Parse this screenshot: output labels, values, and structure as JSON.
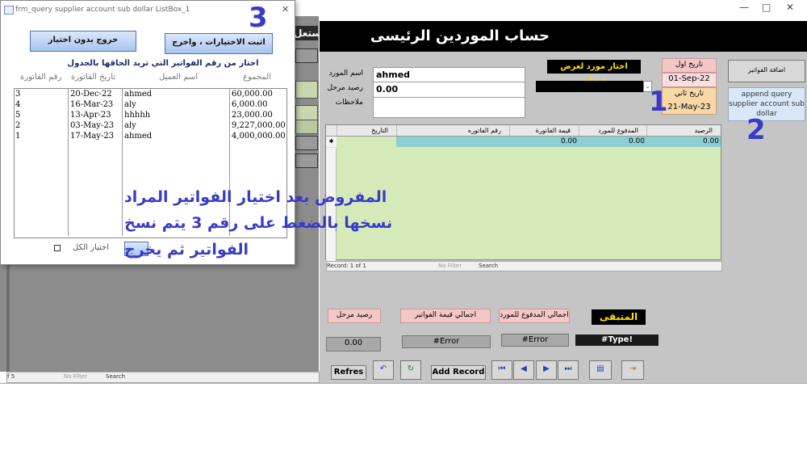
{
  "window_controls": {
    "minimize": "—",
    "maximize": "□",
    "close": "✕"
  },
  "background_form": {
    "partial_title": "ستعل",
    "nav_record": "f 5",
    "nav_filter": "No Filter",
    "nav_search": "Search"
  },
  "main_form": {
    "title": "حساب الموردين الرئيسى",
    "labels": {
      "supplier_name": "اسم المورد",
      "carried_balance": "رصيد مرحل",
      "notes": "ملاحظات"
    },
    "fields": {
      "supplier_name": "ahmed",
      "carried_balance": "0.00",
      "notes": ""
    },
    "choose_supplier_label": "اختار مورد لعرض حسابة",
    "supplier_combo": "",
    "date_first_label": "تاريخ اول",
    "date_first": "01-Sep-22",
    "date_second_label": "تاريخ ثاني",
    "date_second": "21-May-23",
    "add_invoices_button": "اضافة الفواتير",
    "append_query_label": "append query supplier account sub dollar",
    "grid": {
      "columns": [
        "التاريخ",
        "رقم الفاتوره",
        "قيمة الفاتورة",
        "المدفوع للمورد",
        "الرصيد"
      ],
      "row": {
        "date": "",
        "invoice_no": "",
        "invoice_value": "0.00",
        "paid": "0.00",
        "balance": "0.00"
      },
      "nav_record": "Record: 1 of 1",
      "nav_filter": "No Filter",
      "nav_search": "Search"
    },
    "totals": {
      "carried_balance_label": "رصيد مرحل",
      "invoices_total_label": "اجمالي قيمة الفواتير",
      "paid_total_label": "اجمالي المدفوع للمورد",
      "remaining_label": "المتبقى",
      "carried_balance_value": "0.00",
      "invoices_total_value": "#Error",
      "paid_total_value": "#Error",
      "remaining_value": "#Type!"
    },
    "buttons": {
      "refresh": "Refres",
      "add_record": "Add Record"
    }
  },
  "dialog": {
    "title": "frm_query supplier account sub dollar ListBox_1",
    "close": "✕",
    "apply_button": "اثبت الاختيارات ، واخرج",
    "exit_button": "خروج بدون اختيار",
    "instruction": "اختار من رقم الفواتير التي تريد الحاقها بالجدول",
    "columns": [
      "رقم الفاتورة",
      "تاريخ الفاتورة",
      "اسم العميل",
      "المجموع"
    ],
    "rows": [
      {
        "invoice_no": "3",
        "date": "20-Dec-22",
        "customer": "ahmed",
        "total": "60,000.00"
      },
      {
        "invoice_no": "4",
        "date": "16-Mar-23",
        "customer": "aly",
        "total": "6,000.00"
      },
      {
        "invoice_no": "5",
        "date": "13-Apr-23",
        "customer": "hhhhh",
        "total": "23,000.00"
      },
      {
        "invoice_no": "2",
        "date": "03-May-23",
        "customer": "aly",
        "total": "9,227,000.00"
      },
      {
        "invoice_no": "1",
        "date": "17-May-23",
        "customer": "ahmed",
        "total": "4,000,000.00"
      }
    ],
    "select_all_label": "اختيار الكل"
  },
  "annotations": {
    "num1": "1",
    "num2": "2",
    "num3": "3",
    "hint_line1": "المفروض بعد اختيار الفواتير المراد",
    "hint_line2": "نسخها بالضغط على رقم 3  يتم نسخ",
    "hint_line3": "الفواتير ثم يخرج"
  },
  "colors": {
    "header": "#000000",
    "grid_bg": "#d4eab8",
    "selected_row": "#8ecfd4",
    "annotation": "#3a3ac8",
    "pink": "#f5c6c6"
  }
}
